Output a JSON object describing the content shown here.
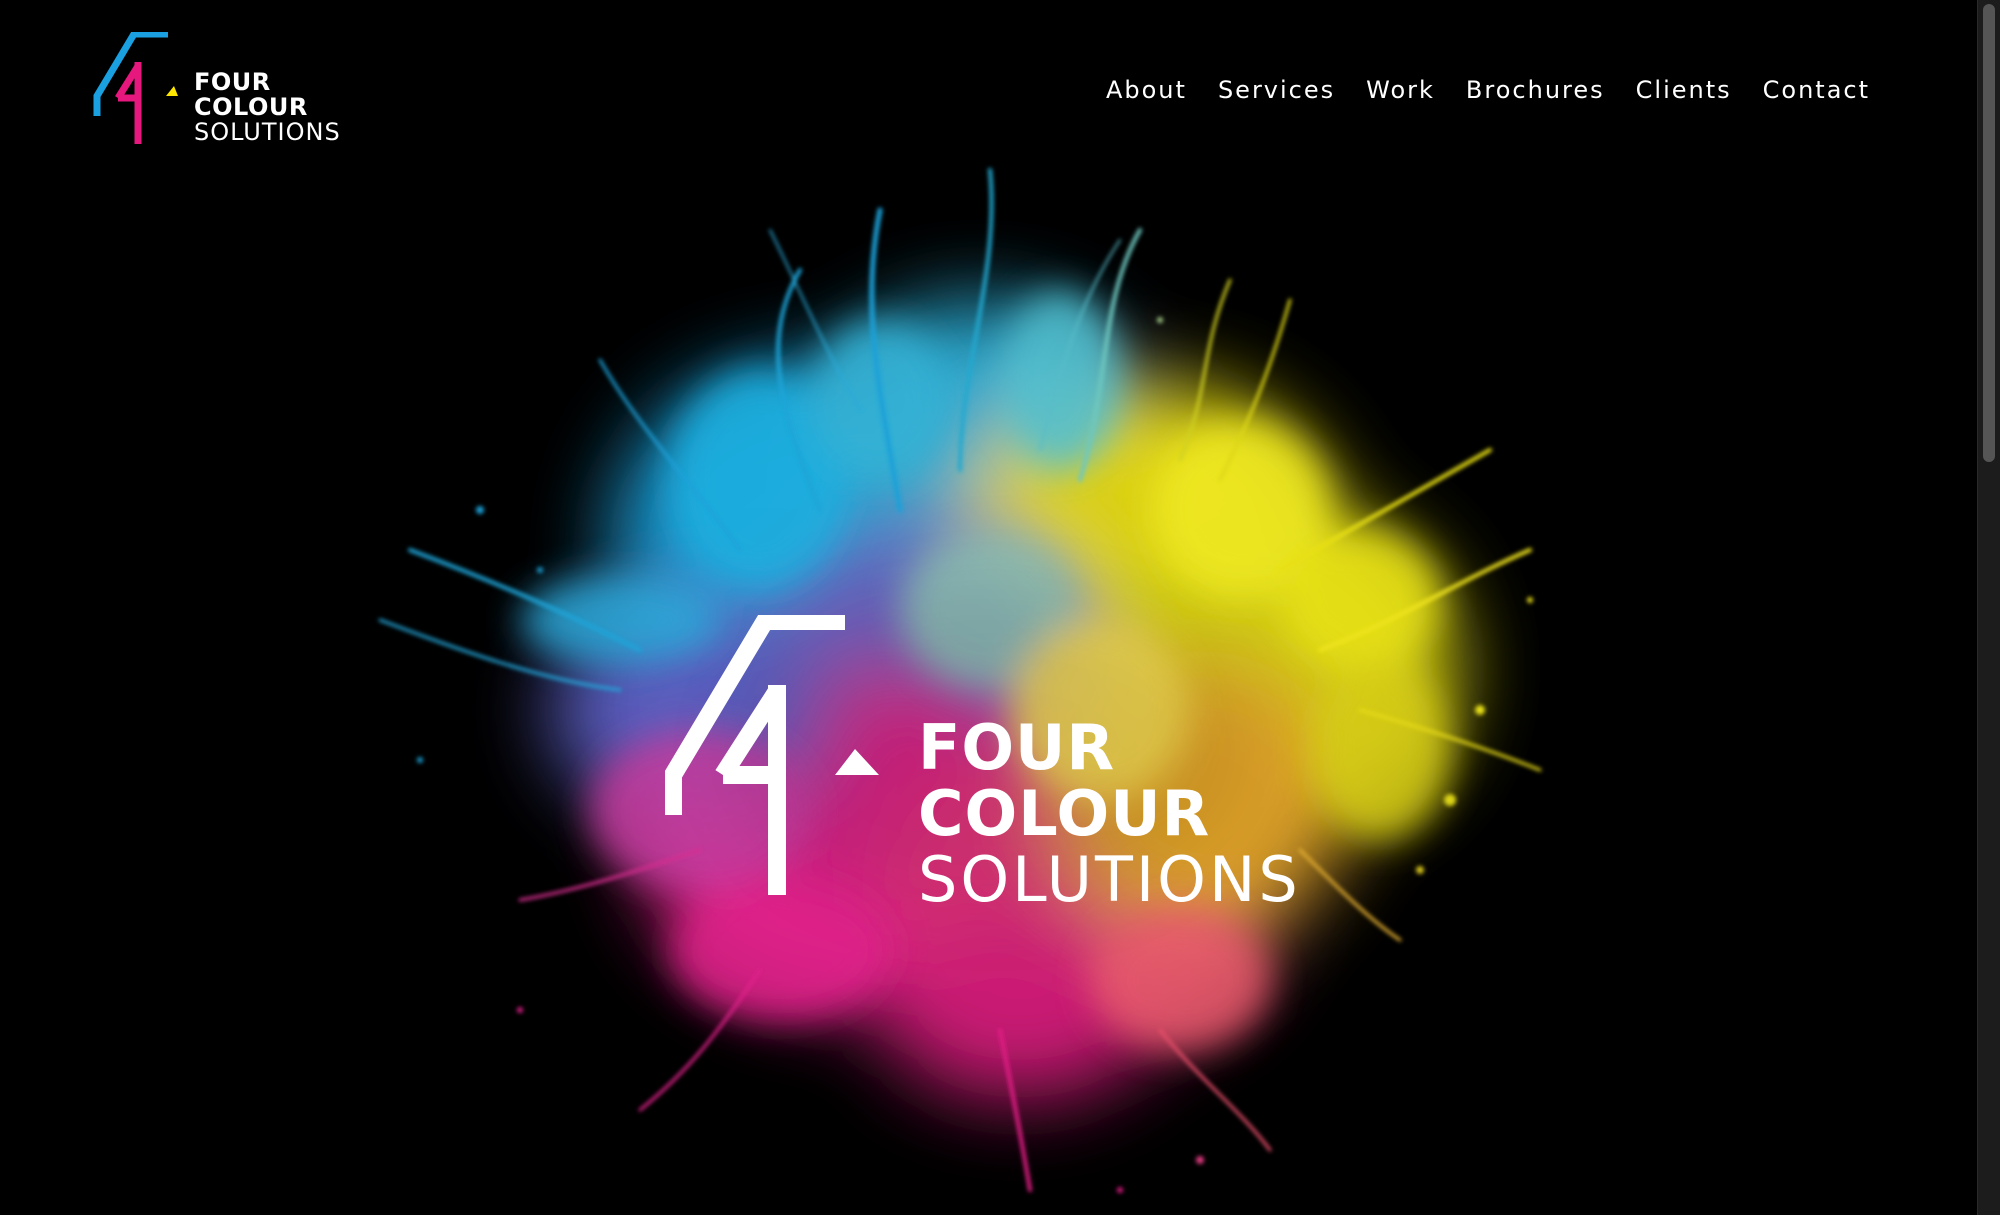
{
  "brand": {
    "line1": "FOUR",
    "line2": "COLOUR",
    "line3": "SOLUTIONS",
    "colors": {
      "cyan": "#1aa0e0",
      "magenta": "#e6187e",
      "yellow": "#ffe600",
      "white": "#ffffff"
    }
  },
  "nav": {
    "items": [
      {
        "label": "About"
      },
      {
        "label": "Services"
      },
      {
        "label": "Work"
      },
      {
        "label": "Brochures"
      },
      {
        "label": "Clients"
      },
      {
        "label": "Contact"
      }
    ]
  },
  "hero": {
    "line1": "FOUR",
    "line2": "COLOUR",
    "line3": "SOLUTIONS",
    "background": "color-powder-explosion",
    "palette": [
      "#19a7d8",
      "#e01d84",
      "#f4ea12",
      "#5a5ad0"
    ]
  },
  "page": {
    "background": "#000000"
  }
}
